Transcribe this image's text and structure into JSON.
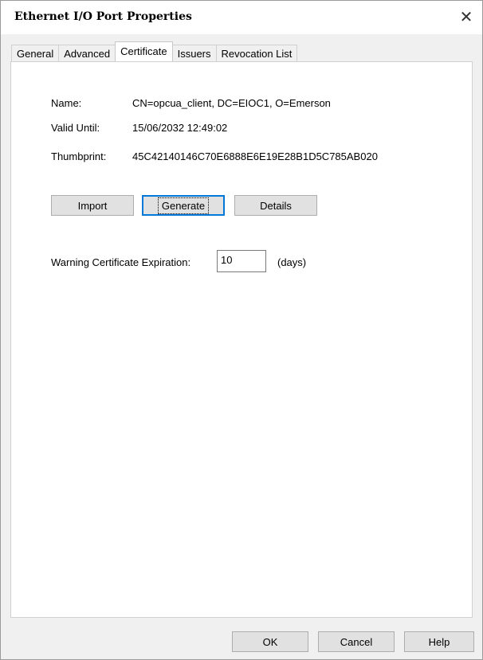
{
  "window": {
    "title": "Ethernet I/O Port Properties",
    "close_icon": "close-icon"
  },
  "tabs": [
    {
      "label": "General",
      "active": false
    },
    {
      "label": "Advanced",
      "active": false
    },
    {
      "label": "Certificate",
      "active": true
    },
    {
      "label": "Issuers",
      "active": false
    },
    {
      "label": "Revocation List",
      "active": false
    }
  ],
  "certificate": {
    "name_label": "Name:",
    "name_value": "CN=opcua_client, DC=EIOC1, O=Emerson",
    "valid_label": "Valid Until:",
    "valid_value": "15/06/2032 12:49:02",
    "thumbprint_label": "Thumbprint:",
    "thumbprint_value": "45C42140146C70E6888E6E19E28B1D5C785AB020"
  },
  "actions": {
    "import_label": "Import",
    "generate_label": "Generate",
    "details_label": "Details"
  },
  "expiration": {
    "label": "Warning Certificate Expiration:",
    "value": "10",
    "unit": "(days)"
  },
  "footer": {
    "ok_label": "OK",
    "cancel_label": "Cancel",
    "help_label": "Help"
  }
}
